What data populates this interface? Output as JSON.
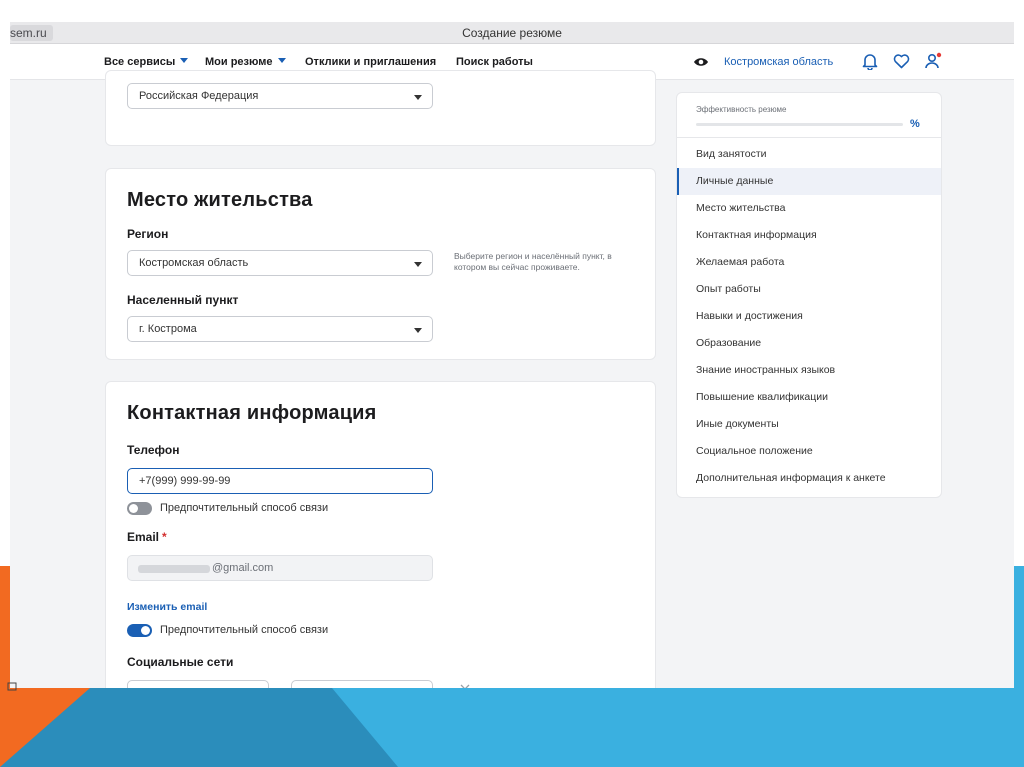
{
  "browser": {
    "url": "sem.ru",
    "title": "Создание резюме"
  },
  "nav": {
    "items": [
      "Все сервисы",
      "Мои резюме",
      "Отклики и приглашения",
      "Поиск работы"
    ],
    "region": "Костромская область"
  },
  "citizenship": {
    "value": "Российская Федерация"
  },
  "residence": {
    "title": "Место жительства",
    "region_label": "Регион",
    "region_value": "Костромская область",
    "region_hint": "Выберите регион и населённый пункт, в котором вы сейчас проживаете.",
    "city_label": "Населенный пункт",
    "city_value": "г. Кострома"
  },
  "contact": {
    "title": "Контактная информация",
    "phone_label": "Телефон",
    "phone_value": "+7(999) 999-99-99",
    "phone_pref_label": "Предпочтительный способ связи",
    "phone_pref_on": false,
    "email_label": "Email",
    "email_required": "*",
    "email_value": "@gmail.com",
    "change_email": "Изменить email",
    "email_pref_label": "Предпочтительный способ связи",
    "email_pref_on": true,
    "social_label": "Социальные сети"
  },
  "sidebar": {
    "efficiency_title": "Эффективность резюме",
    "efficiency_suffix": "%",
    "items": [
      "Вид занятости",
      "Личные данные",
      "Место жительства",
      "Контактная информация",
      "Желаемая работа",
      "Опыт работы",
      "Навыки и достижения",
      "Образование",
      "Знание иностранных языков",
      "Повышение квалификации",
      "Иные документы",
      "Социальное положение",
      "Дополнительная информация к анкете"
    ],
    "active_index": 1
  },
  "colors": {
    "accent": "#1a5fb4",
    "slide_orange": "#f26a21",
    "slide_blue": "#3ab0e0",
    "slide_dark": "#2b8dbb"
  },
  "icons": [
    "eye-icon",
    "bell-icon",
    "heart-icon",
    "user-icon",
    "dropdown-caret-icon",
    "close-icon"
  ]
}
